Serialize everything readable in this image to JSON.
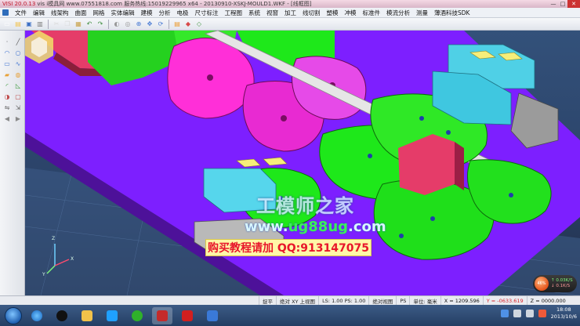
{
  "window": {
    "app_version": "VISI 20.0.13",
    "title_rest": "vis i模具网 www.07551818.com 服务热线:15019229965 x64 - 20130910-XSKJ-MOULD1.WKF - [线框图]",
    "title_badge": "[线框图]",
    "controls": {
      "minimize": "—",
      "maximize": "□",
      "close": "✕"
    }
  },
  "menu": [
    "文件",
    "编辑",
    "线架构",
    "曲面",
    "网格",
    "实体编辑",
    "建模",
    "分析",
    "电极",
    "尺寸标注",
    "工程图",
    "系统",
    "视窗",
    "加工",
    "线切割",
    "塑模",
    "冲模",
    "标准件",
    "模流分析",
    "测量",
    "薄酒科技SDK"
  ],
  "toolbar_icons": [
    {
      "name": "new-file-icon",
      "glyph": "▭",
      "color": "#ffffff"
    },
    {
      "name": "open-folder-icon",
      "glyph": "▤",
      "color": "#f2c24a"
    },
    {
      "name": "save-icon",
      "glyph": "▣",
      "color": "#3b6fc4"
    },
    {
      "name": "print-icon",
      "glyph": "▥",
      "color": "#7a7a7a"
    },
    {
      "name": "cut-icon",
      "glyph": "✂",
      "color": "#d9d9d9"
    },
    {
      "name": "copy-icon",
      "glyph": "❐",
      "color": "#d9d9d9"
    },
    {
      "name": "paste-icon",
      "glyph": "▦",
      "color": "#c9a24a"
    },
    {
      "name": "undo-icon",
      "glyph": "↶",
      "color": "#3a8b3a"
    },
    {
      "name": "redo-icon",
      "glyph": "↷",
      "color": "#3a8b3a"
    },
    {
      "name": "shaded-view-icon",
      "glyph": "◐",
      "color": "#999999"
    },
    {
      "name": "wireframe-view-icon",
      "glyph": "◎",
      "color": "#999999"
    },
    {
      "name": "zoom-icon",
      "glyph": "⊕",
      "color": "#4a7bd4"
    },
    {
      "name": "pan-icon",
      "glyph": "✥",
      "color": "#4a7bd4"
    },
    {
      "name": "rotate-icon",
      "glyph": "⟳",
      "color": "#4a7bd4"
    },
    {
      "name": "layer-icon",
      "glyph": "▤",
      "color": "#ec9a2c"
    },
    {
      "name": "color-icon",
      "glyph": "◆",
      "color": "#d84a4a"
    },
    {
      "name": "measure-icon",
      "glyph": "◇",
      "color": "#4a9a4a"
    }
  ],
  "left_tool_icons": [
    {
      "name": "point-icon",
      "glyph": "·",
      "color": "#5a5a5a"
    },
    {
      "name": "line-icon",
      "glyph": "╱",
      "color": "#5a5a5a"
    },
    {
      "name": "arc-icon",
      "glyph": "◠",
      "color": "#4a7bd4"
    },
    {
      "name": "circle-icon",
      "glyph": "○",
      "color": "#4a7bd4"
    },
    {
      "name": "rectangle-icon",
      "glyph": "▭",
      "color": "#4a7bd4"
    },
    {
      "name": "spline-icon",
      "glyph": "∿",
      "color": "#4a7bd4"
    },
    {
      "name": "extrude-icon",
      "glyph": "▰",
      "color": "#e8a23a"
    },
    {
      "name": "revolve-icon",
      "glyph": "◍",
      "color": "#e8a23a"
    },
    {
      "name": "fillet-icon",
      "glyph": "◜",
      "color": "#3a9a3a"
    },
    {
      "name": "chamfer-icon",
      "glyph": "◺",
      "color": "#3a9a3a"
    },
    {
      "name": "boolean-icon",
      "glyph": "◑",
      "color": "#c04a4a"
    },
    {
      "name": "shell-icon",
      "glyph": "▢",
      "color": "#c04a4a"
    },
    {
      "name": "mirror-icon",
      "glyph": "⇋",
      "color": "#6a6a6a"
    },
    {
      "name": "transform-icon",
      "glyph": "⇲",
      "color": "#6a6a6a"
    },
    {
      "name": "arrow-left-icon",
      "glyph": "◀",
      "color": "#8a8a8a"
    },
    {
      "name": "arrow-right-icon",
      "glyph": "▶",
      "color": "#8a8a8a"
    }
  ],
  "viewport": {
    "watermark_title": "工模师之家",
    "watermark_site_prefix": "www.",
    "watermark_site_highlight": "ug88ug",
    "watermark_site_suffix": ".com",
    "watermark_ad": "购买教程请加 QQ:913147075",
    "axis": {
      "x": "X",
      "y": "Y",
      "z": "Z"
    },
    "speed": {
      "percent": "46%",
      "up": "↑ 0.03K/S",
      "down": "↓ 0.1K/S"
    }
  },
  "status": {
    "mode": "捉平",
    "view": "绝对 XY 上视图",
    "ls": "LS: 1.00 PS: 1.00",
    "rel_view": "绝对视图",
    "ps": "PS",
    "unit": "单位: 毫米",
    "x": "X = 1209.596",
    "y": "Y = -0633.619",
    "z": "Z = 0000.000"
  },
  "clock": {
    "time": "18:08",
    "date": "2013/10/6"
  },
  "colors": {
    "magenta_part": "#ff2fd8",
    "green_part": "#1ee81a",
    "purple_plate": "#7d1fff",
    "blue_slider": "#4fd0e6",
    "red_block": "#e53c69",
    "yellow_pad": "#f5ee7a"
  }
}
